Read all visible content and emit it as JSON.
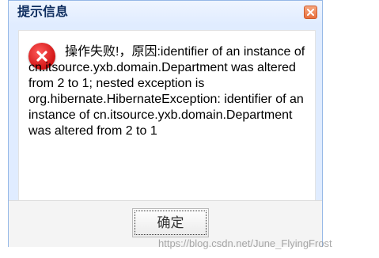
{
  "dialog": {
    "title": "提示信息",
    "close_icon": "close-x-icon",
    "message": "操作失败!，原因:identifier of an instance of cn.itsource.yxb.domain.Department was altered from 2 to 1; nested exception is org.hibernate.HibernateException: identifier of an instance of cn.itsource.yxb.domain.Department was altered from 2 to 1",
    "status_icon": "error-icon",
    "ok_label": "确定"
  },
  "watermark": "https://blog.csdn.net/June_FlyingFrost",
  "colors": {
    "header_bg": "#e0ecff",
    "border": "#95b8e7",
    "title_text": "#0e2d5f",
    "close_button": "#e8703f",
    "error_icon": "#d01414"
  }
}
